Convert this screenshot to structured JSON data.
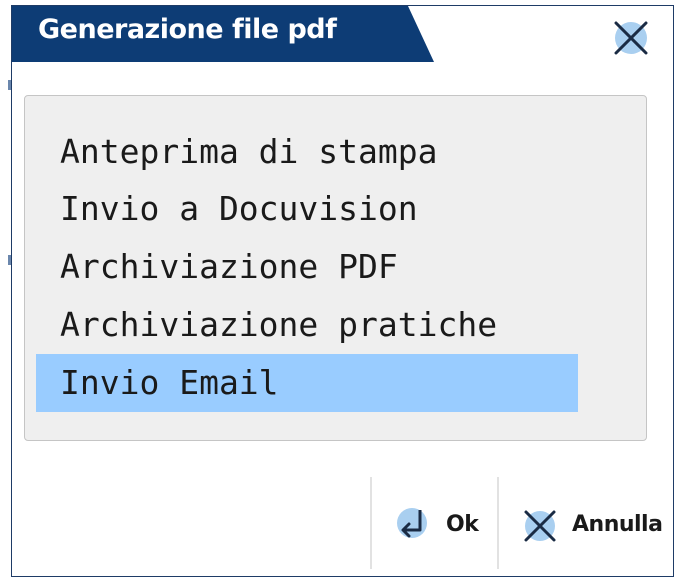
{
  "dialog": {
    "title": "Generazione file pdf",
    "close_icon": "close-icon"
  },
  "options": {
    "items": [
      {
        "label": "Anteprima di stampa",
        "selected": false
      },
      {
        "label": "Invio a Docuvision",
        "selected": false
      },
      {
        "label": "Archiviazione PDF",
        "selected": false
      },
      {
        "label": "Archiviazione pratiche",
        "selected": false
      },
      {
        "label": "Invio Email",
        "selected": true
      }
    ],
    "selected_color": "#99ccff"
  },
  "footer": {
    "ok_label": "Ok",
    "ok_icon": "enter-arrow-icon",
    "cancel_label": "Annulla",
    "cancel_icon": "close-icon"
  },
  "colors": {
    "title_bar": "#0d3c75",
    "close_halo": "#a9cff0",
    "panel_bg": "#efefef"
  }
}
